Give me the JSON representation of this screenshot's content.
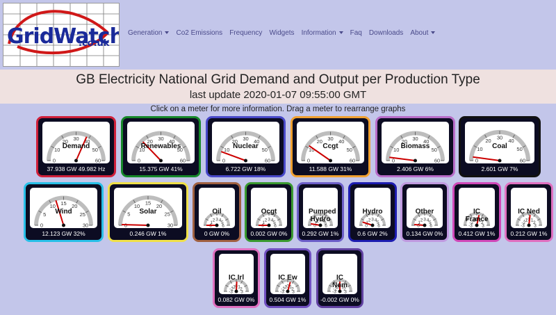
{
  "logo": {
    "name": "GridWatch",
    "suffix": ".co.uk"
  },
  "nav": [
    {
      "label": "Generation",
      "dropdown": true
    },
    {
      "label": "Co2 Emissions",
      "dropdown": false
    },
    {
      "label": "Frequency",
      "dropdown": false
    },
    {
      "label": "Widgets",
      "dropdown": false
    },
    {
      "label": "Information",
      "dropdown": true
    },
    {
      "label": "Faq",
      "dropdown": false
    },
    {
      "label": "Downloads",
      "dropdown": false
    },
    {
      "label": "About",
      "dropdown": true
    }
  ],
  "page": {
    "title": "GB Electricity National Grid Demand and Output per Production Type",
    "last_update": "last update 2020-01-07 09:55:00 GMT",
    "hint": "Click on a meter for more information. Drag a meter to rearrange graphs"
  },
  "colors": {
    "background": "#c3c6ea",
    "header_band": "#efe1e0",
    "meter_body": "#0c0c22",
    "needle": "#cc0000"
  },
  "meters": [
    {
      "id": "demand",
      "label": "Demand",
      "reading": "37.938 GW 49.982 Hz",
      "ticks": [
        "0",
        "10",
        "20",
        "30",
        "40",
        "50",
        "60"
      ],
      "value": 37.938,
      "max": 60,
      "border": "#d0203a"
    },
    {
      "id": "renewables",
      "label": "Renewables",
      "reading": "15.375 GW 41%",
      "ticks": [
        "0",
        "10",
        "20",
        "30",
        "40",
        "50",
        "60"
      ],
      "value": 15.375,
      "max": 60,
      "border": "#16882a"
    },
    {
      "id": "nuclear",
      "label": "Nuclear",
      "reading": "6.722 GW 18%",
      "ticks": [
        "0",
        "10",
        "20",
        "30",
        "40",
        "50",
        "60"
      ],
      "value": 6.722,
      "max": 60,
      "border": "#4848c8"
    },
    {
      "id": "ccgt",
      "label": "Ccgt",
      "reading": "11.588 GW 31%",
      "ticks": [
        "0",
        "10",
        "20",
        "30",
        "40",
        "50",
        "60"
      ],
      "value": 11.588,
      "max": 60,
      "border": "#f0a030"
    },
    {
      "id": "biomass",
      "label": "Biomass",
      "reading": "2.406 GW 6%",
      "ticks": [
        "0",
        "10",
        "20",
        "30",
        "40",
        "50",
        "60"
      ],
      "value": 2.406,
      "max": 60,
      "border": "#b86cc8"
    },
    {
      "id": "coal",
      "label": "Coal",
      "reading": "2.601 GW 7%",
      "ticks": [
        "0",
        "10",
        "20",
        "30",
        "40",
        "50",
        "60"
      ],
      "value": 2.601,
      "max": 60,
      "border": "#111111"
    },
    {
      "id": "wind",
      "label": "Wind",
      "reading": "12.123 GW 32%",
      "ticks": [
        "0",
        "5",
        "10",
        "15",
        "20",
        "25",
        "30"
      ],
      "value": 12.123,
      "max": 30,
      "border": "#28c0e8"
    },
    {
      "id": "solar",
      "label": "Solar",
      "reading": "0.246 GW 1%",
      "ticks": [
        "0",
        "5",
        "10",
        "15",
        "20",
        "25",
        "30"
      ],
      "value": 0.246,
      "max": 30,
      "border": "#f0e048"
    },
    {
      "id": "oil",
      "label": "Oil",
      "reading": "0 GW 0%",
      "ticks": [
        "0",
        "1",
        "2",
        "3",
        "4",
        "5",
        "6"
      ],
      "value": 0,
      "max": 6,
      "border": "#a06040"
    },
    {
      "id": "ocgt",
      "label": "Ocgt",
      "reading": "0.002 GW 0%",
      "ticks": [
        "0",
        "1",
        "2",
        "3",
        "4",
        "5",
        "6"
      ],
      "value": 0.002,
      "max": 6,
      "border": "#3a9a30"
    },
    {
      "id": "pumped",
      "label": "Pumped Hydro",
      "reading": "0.292 GW 1%",
      "ticks": [
        "0",
        "1",
        "2",
        "3",
        "4",
        "5",
        "6"
      ],
      "value": 0.292,
      "max": 6,
      "border": "#6c5ec8"
    },
    {
      "id": "hydro",
      "label": "Hydro",
      "reading": "0.6 GW 2%",
      "ticks": [
        "0",
        "1",
        "2",
        "3",
        "4",
        "5",
        "6"
      ],
      "value": 0.6,
      "max": 6,
      "border": "#1c1cb0"
    },
    {
      "id": "other",
      "label": "Other",
      "reading": "0.134 GW 0%",
      "ticks": [
        "0",
        "1",
        "2",
        "3",
        "4",
        "5",
        "6"
      ],
      "value": 0.134,
      "max": 6,
      "border": "#c09ae0"
    },
    {
      "id": "icfrance",
      "label": "IC France",
      "reading": "0.412 GW 1%",
      "ticks": [
        "-3",
        "-2",
        "-1",
        "0",
        "1",
        "2",
        "3"
      ],
      "value": 0.412,
      "min": -3,
      "max": 3,
      "border": "#d048b8"
    },
    {
      "id": "icned",
      "label": "IC Ned",
      "reading": "0.212 GW 1%",
      "ticks": [
        "-3",
        "-2",
        "-1",
        "0",
        "1",
        "2",
        "3"
      ],
      "value": 0.212,
      "min": -3,
      "max": 3,
      "border": "#e070c0"
    },
    {
      "id": "icirl",
      "label": "IC Irl",
      "reading": "0.082 GW 0%",
      "ticks": [
        "-3",
        "-2",
        "-1",
        "0",
        "1",
        "2",
        "3"
      ],
      "value": 0.082,
      "min": -3,
      "max": 3,
      "border": "#e070c0"
    },
    {
      "id": "icew",
      "label": "IC Ew",
      "reading": "0.504 GW 1%",
      "ticks": [
        "-3",
        "-2",
        "-1",
        "0",
        "1",
        "2",
        "3"
      ],
      "value": 0.504,
      "min": -3,
      "max": 3,
      "border": "#7050c0"
    },
    {
      "id": "icnem",
      "label": "IC Nem",
      "reading": "-0.002 GW 0%",
      "ticks": [
        "-3",
        "-2",
        "-1",
        "0",
        "1",
        "2",
        "3"
      ],
      "value": -0.002,
      "min": -3,
      "max": 3,
      "border": "#6040a0"
    }
  ]
}
